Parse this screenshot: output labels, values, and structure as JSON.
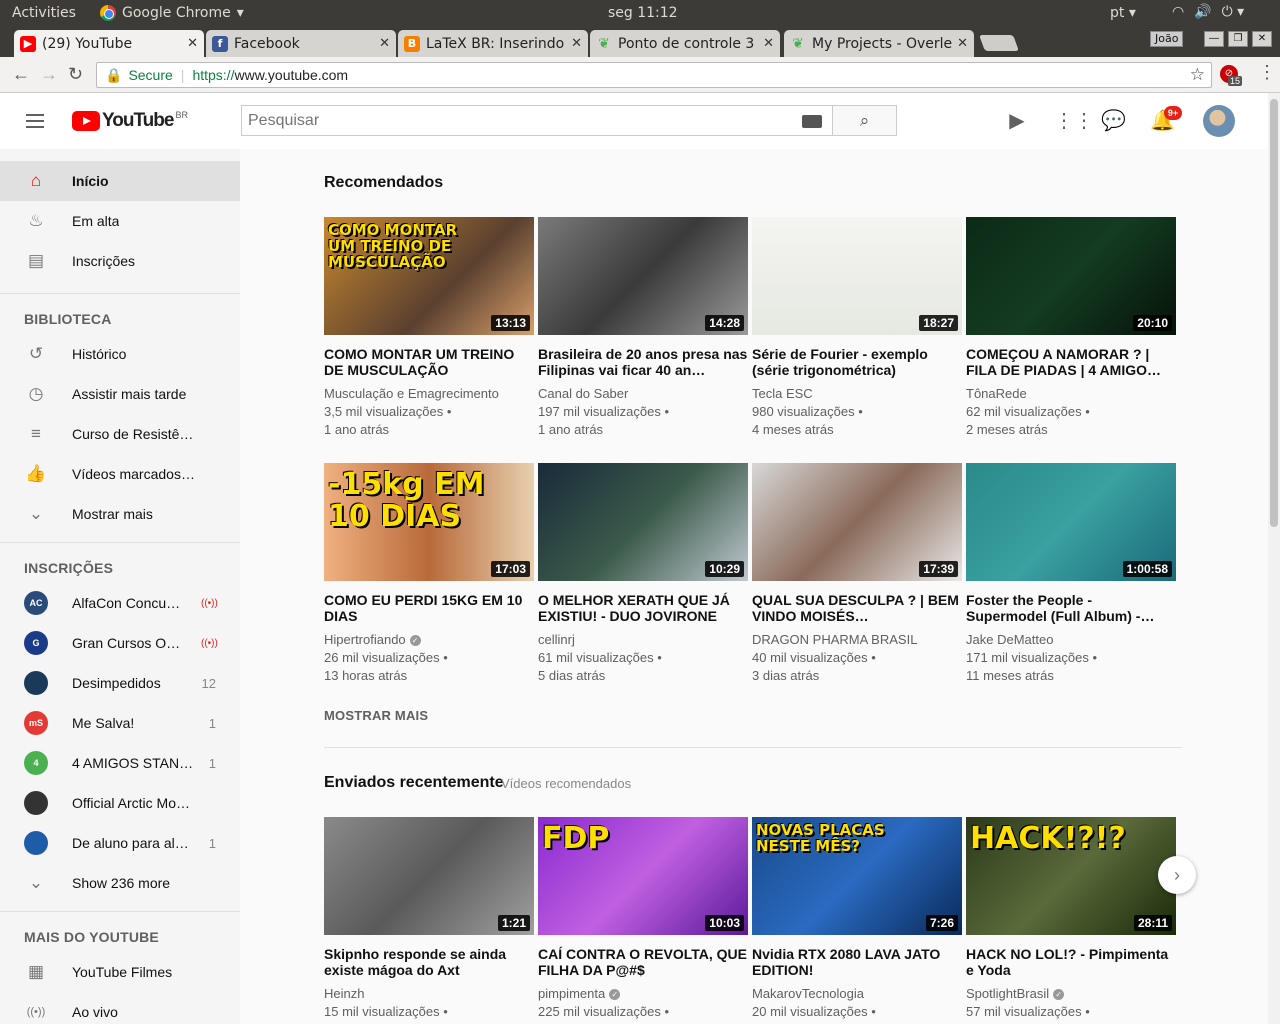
{
  "os": {
    "activities": "Activities",
    "app_name": "Google Chrome",
    "clock": "seg 11:12",
    "lang": "pt"
  },
  "tabs": [
    {
      "title": "(29) YouTube",
      "fav_color": "#ff0000"
    },
    {
      "title": "Facebook",
      "fav_color": "#3b5998"
    },
    {
      "title": "LaTeX BR: Inserindo",
      "fav_color": "#f57d00"
    },
    {
      "title": "Ponto de controle 3",
      "fav_color": "#4caf50"
    },
    {
      "title": "My Projects - Overle",
      "fav_color": "#4caf50"
    }
  ],
  "user_chip": "João",
  "omnibox": {
    "secure": "Secure",
    "proto": "https://",
    "host": "www.youtube.com"
  },
  "extension_badge": "15",
  "youtube": {
    "logo_word": "YouTube",
    "logo_country": "BR",
    "search_placeholder": "Pesquisar",
    "notif_count": "9+"
  },
  "sidebar": {
    "main": [
      {
        "label": "Início",
        "icon": "home-icon",
        "glyph": "⌂"
      },
      {
        "label": "Em alta",
        "icon": "flame-icon",
        "glyph": "🔥"
      },
      {
        "label": "Inscrições",
        "icon": "subscriptions-icon",
        "glyph": "▤"
      }
    ],
    "library_heading": "BIBLIOTECA",
    "library": [
      {
        "label": "Histórico",
        "glyph": "↺"
      },
      {
        "label": "Assistir mais tarde",
        "glyph": "◷"
      },
      {
        "label": "Curso de Resistê…",
        "glyph": "≡"
      },
      {
        "label": "Vídeos marcados…",
        "glyph": "👍"
      },
      {
        "label": "Mostrar mais",
        "glyph": "⌄"
      }
    ],
    "subs_heading": "INSCRIÇÕES",
    "subs": [
      {
        "label": "AlfaCon Concu…",
        "count": "",
        "live": true,
        "avatar": "AC",
        "color": "#2a4a7a"
      },
      {
        "label": "Gran Cursos O…",
        "count": "",
        "live": true,
        "avatar": "G",
        "color": "#1a3a8a"
      },
      {
        "label": "Desimpedidos",
        "count": "12",
        "live": false,
        "avatar": "",
        "color": "#1b3a5a"
      },
      {
        "label": "Me Salva!",
        "count": "1",
        "live": false,
        "avatar": "mS",
        "color": "#e53935"
      },
      {
        "label": "4 AMIGOS STAN…",
        "count": "1",
        "live": false,
        "avatar": "4",
        "color": "#4caf50"
      },
      {
        "label": "Official Arctic Mo…",
        "count": "",
        "live": false,
        "avatar": "",
        "color": "#333333"
      },
      {
        "label": "De aluno para al…",
        "count": "1",
        "live": false,
        "avatar": "",
        "color": "#1e5ca8"
      }
    ],
    "show_more": "Show 236 more",
    "more_heading": "MAIS DO YOUTUBE",
    "more": [
      {
        "label": "YouTube Filmes",
        "glyph": "▦"
      },
      {
        "label": "Ao vivo",
        "glyph": "((•))"
      }
    ]
  },
  "recommended": {
    "title": "Recomendados",
    "videos": [
      {
        "title": "COMO MONTAR UM TREINO DE MUSCULAÇÃO",
        "channel": "Musculação e Emagrecimento",
        "verified": false,
        "views": "3,5 mil visualizações",
        "age": "1 ano atrás",
        "duration": "13:13",
        "bg": "linear-gradient(135deg,#c8892e,#5a4030 60%,#d9a06a)",
        "overlay": "COMO MONTAR UM TREINO DE MUSCULAÇÃO"
      },
      {
        "title": "Brasileira de 20 anos presa nas Filipinas vai ficar 40 an…",
        "channel": "Canal do Saber",
        "verified": false,
        "views": "197 mil visualizações",
        "age": "1 ano atrás",
        "duration": "14:28",
        "bg": "linear-gradient(135deg,#7a7a7a,#3a3a3a 50%,#9a9a9a)",
        "overlay": ""
      },
      {
        "title": "Série de Fourier - exemplo (série trigonométrica)",
        "channel": "Tecla ESC",
        "verified": false,
        "views": "980 visualizações",
        "age": "4 meses atrás",
        "duration": "18:27",
        "bg": "linear-gradient(180deg,#f4f4f0,#e6e8e2)",
        "overlay": ""
      },
      {
        "title": "COMEÇOU A NAMORAR ? | FILA DE PIADAS | 4 AMIGO…",
        "channel": "TônaRede",
        "verified": false,
        "views": "62 mil visualizações",
        "age": "2 meses atrás",
        "duration": "20:10",
        "bg": "linear-gradient(135deg,#0c2a16,#143c22 50%,#061208)",
        "overlay": ""
      },
      {
        "title": "COMO EU PERDI 15KG EM 10 DIAS",
        "channel": "Hipertrofiando",
        "verified": true,
        "views": "26 mil visualizações",
        "age": "13 horas atrás",
        "duration": "17:03",
        "bg": "linear-gradient(90deg,#f0b080,#b86a3a 50%,#e8d0b0)",
        "overlay": "-15kg EM 10 DIAS"
      },
      {
        "title": "O MELHOR XERATH QUE JÁ EXISTIU! - DUO JOVIRONE",
        "channel": "cellinrj",
        "verified": false,
        "views": "61 mil visualizações",
        "age": "5 dias atrás",
        "duration": "10:29",
        "bg": "linear-gradient(135deg,#1a2a3a,#3a5a4a 50%,#c0c8d0)",
        "overlay": ""
      },
      {
        "title": "QUAL SUA DESCULPA ? | BEM VINDO MOISÉS…",
        "channel": "DRAGON PHARMA BRASIL",
        "verified": false,
        "views": "40 mil visualizações",
        "age": "3 dias atrás",
        "duration": "17:39",
        "bg": "linear-gradient(135deg,#d8d8d8,#8a6a5a 50%,#e8e8e8)",
        "overlay": ""
      },
      {
        "title": "Foster the People - Supermodel (Full Album) -…",
        "channel": "Jake DeMatteo",
        "verified": false,
        "views": "171 mil visualizações",
        "age": "11 meses atrás",
        "duration": "1:00:58",
        "bg": "linear-gradient(135deg,#2a8a8a,#3aa0a0 50%,#1a6a7a)",
        "overlay": ""
      }
    ],
    "show_more": "MOSTRAR MAIS"
  },
  "recent": {
    "title": "Enviados recentemente",
    "subtitle": "Vídeos recomendados",
    "videos": [
      {
        "title": "Skipnho responde se ainda existe mágoa do Axt",
        "channel": "Heinzh",
        "verified": false,
        "views": "15 mil visualizações",
        "duration": "1:21",
        "bg": "linear-gradient(135deg,#8a8a8a,#5a5a5a 50%,#a0a0a0)",
        "overlay": ""
      },
      {
        "title": "CAÍ CONTRA O REVOLTA, QUE FILHA DA P@#$",
        "channel": "pimpimenta",
        "verified": true,
        "views": "225 mil visualizações",
        "duration": "10:03",
        "bg": "linear-gradient(135deg,#8a2ad0,#c060e0 50%,#5a1a9a)",
        "overlay": "FDP"
      },
      {
        "title": "Nvidia RTX 2080 LAVA JATO EDITION!",
        "channel": "MakarovTecnologia",
        "verified": false,
        "views": "20 mil visualizações",
        "duration": "7:26",
        "bg": "linear-gradient(135deg,#1a4a8a,#2a6ac0 50%,#0a2a5a)",
        "overlay": "NOVAS PLACAS NESTE MÊS?"
      },
      {
        "title": "HACK NO LOL!? - Pimpimenta e Yoda",
        "channel": "SpotlightBrasil",
        "verified": true,
        "views": "57 mil visualizações",
        "duration": "28:11",
        "bg": "linear-gradient(135deg,#2a3a1a,#5a6a3a 50%,#1a2a0a)",
        "overlay": "HACK!?!?"
      }
    ]
  }
}
